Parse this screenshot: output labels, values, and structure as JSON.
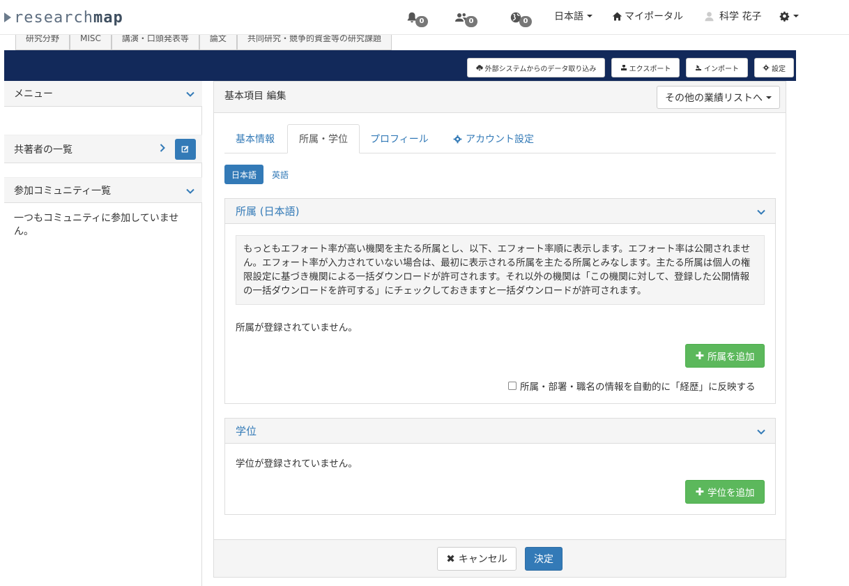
{
  "navbar": {
    "logo_light": "research",
    "logo_bold": "map",
    "notifications_count": "0",
    "contacts_count": "0",
    "world_count": "0",
    "language": "日本語",
    "my_portal": "マイポータル",
    "user_name": "科学 花子"
  },
  "section_tabs": [
    "研究分野",
    "MISC",
    "講演・口頭発表等",
    "論文",
    "共同研究・競争的資金等の研究課題"
  ],
  "toolbar": {
    "import_external": "外部システムからのデータ取り込み",
    "export": "エクスポート",
    "import": "インポート",
    "settings": "設定"
  },
  "sidebar": {
    "menu": "メニュー",
    "coauthors": "共著者の一覧",
    "communities": "参加コミュニティ一覧",
    "no_community": "一つもコミュニティに参加していません。"
  },
  "main": {
    "title": "基本項目 編集",
    "other_lists": "その他の業績リストへ",
    "tabs": [
      "基本情報",
      "所属・学位",
      "プロフィール",
      "アカウント設定"
    ],
    "lang_ja": "日本語",
    "lang_en": "英語",
    "affiliation": {
      "heading": "所属 (日本語)",
      "note": "もっともエフォート率が高い機関を主たる所属とし、以下、エフォート率順に表示します。エフォート率は公開されません。エフォート率が入力されていない場合は、最初に表示される所属を主たる所属とみなします。主たる所属は個人の権限設定に基づき機関による一括ダウンロードが許可されます。それ以外の機関は「この機関に対して、登録した公開情報の一括ダウンロードを許可する」にチェックしておきますと一括ダウンロードが許可されます。",
      "empty": "所属が登録されていません。",
      "add": "所属を追加",
      "checkbox": "所属・部署・職名の情報を自動的に「経歴」に反映する"
    },
    "degree": {
      "heading": "学位",
      "empty": "学位が登録されていません。",
      "add": "学位を追加"
    },
    "cancel": "キャンセル",
    "submit": "決定"
  },
  "colors": {
    "navy": "#12295a",
    "link": "#337ab7",
    "green": "#5cb85c",
    "primary": "#337ab7"
  }
}
